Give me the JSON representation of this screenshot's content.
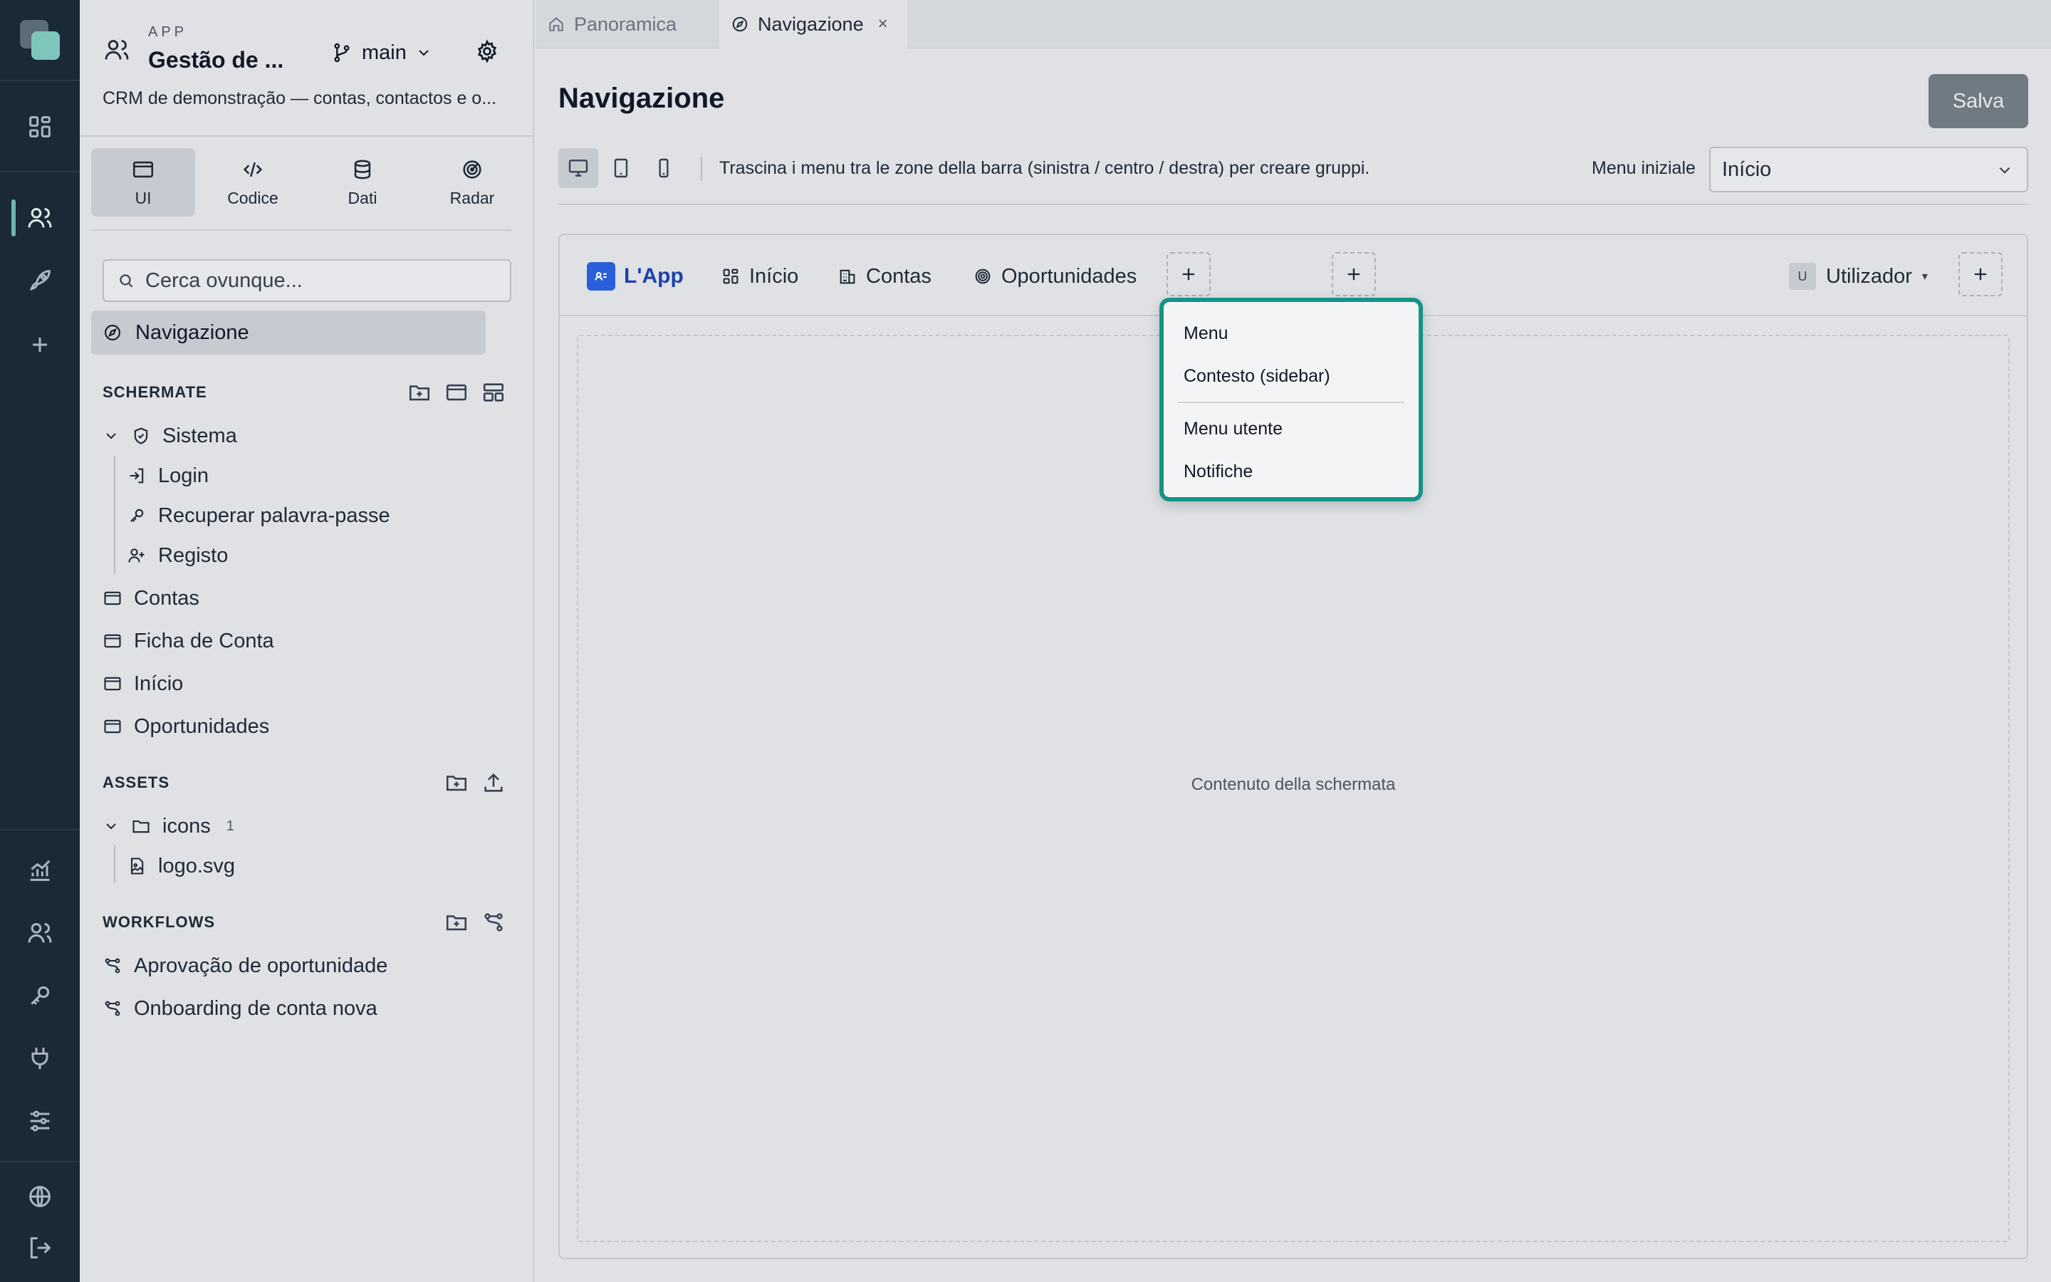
{
  "rail": {
    "icons": [
      "dashboard-icon",
      "users-icon",
      "rocket-icon",
      "plus-icon",
      "analytics-icon",
      "team-icon",
      "key-icon",
      "plug-icon",
      "sliders-icon",
      "globe-icon",
      "logout-icon"
    ]
  },
  "app": {
    "kicker": "APP",
    "title": "Gestão de ...",
    "branch": "main",
    "description": "CRM de demonstração — contas, contactos e o..."
  },
  "modes": [
    {
      "label": "UI"
    },
    {
      "label": "Codice"
    },
    {
      "label": "Dati"
    },
    {
      "label": "Radar"
    }
  ],
  "search": {
    "placeholder": "Cerca ovunque..."
  },
  "nav_selected": "Navigazione",
  "screens": {
    "heading": "SCHERMATE",
    "folder": "Sistema",
    "system_items": [
      "Login",
      "Recuperar palavra-passe",
      "Registo"
    ],
    "items": [
      "Contas",
      "Ficha de Conta",
      "Início",
      "Oportunidades"
    ]
  },
  "assets": {
    "heading": "ASSETS",
    "folder": "icons",
    "folder_count": "1",
    "file": "logo.svg"
  },
  "workflows": {
    "heading": "WORKFLOWS",
    "items": [
      "Aprovação de oportunidade",
      "Onboarding de conta nova"
    ]
  },
  "tabs": [
    {
      "label": "Panoramica"
    },
    {
      "label": "Navigazione",
      "close": "×"
    }
  ],
  "page": {
    "title": "Navigazione",
    "save_label": "Salva"
  },
  "toolbar": {
    "hint": "Trascina i menu tra le zone della barra (sinistra / centro / destra) per creare gruppi.",
    "initial_menu_label": "Menu iniziale",
    "initial_menu_value": "Início"
  },
  "preview": {
    "brand": "L'App",
    "items": [
      "Início",
      "Contas",
      "Oportunidades"
    ],
    "user_initial": "U",
    "user_label": "Utilizador",
    "content_label": "Contenuto della schermata"
  },
  "dropdown": {
    "items": [
      "Menu",
      "Contesto (sidebar)",
      "Menu utente",
      "Notifiche"
    ]
  },
  "colors": {
    "rail_bg": "#192a36",
    "accent_teal": "#149488",
    "brand_blue": "#2b5fd9",
    "save_disabled": "#6f7a83"
  }
}
